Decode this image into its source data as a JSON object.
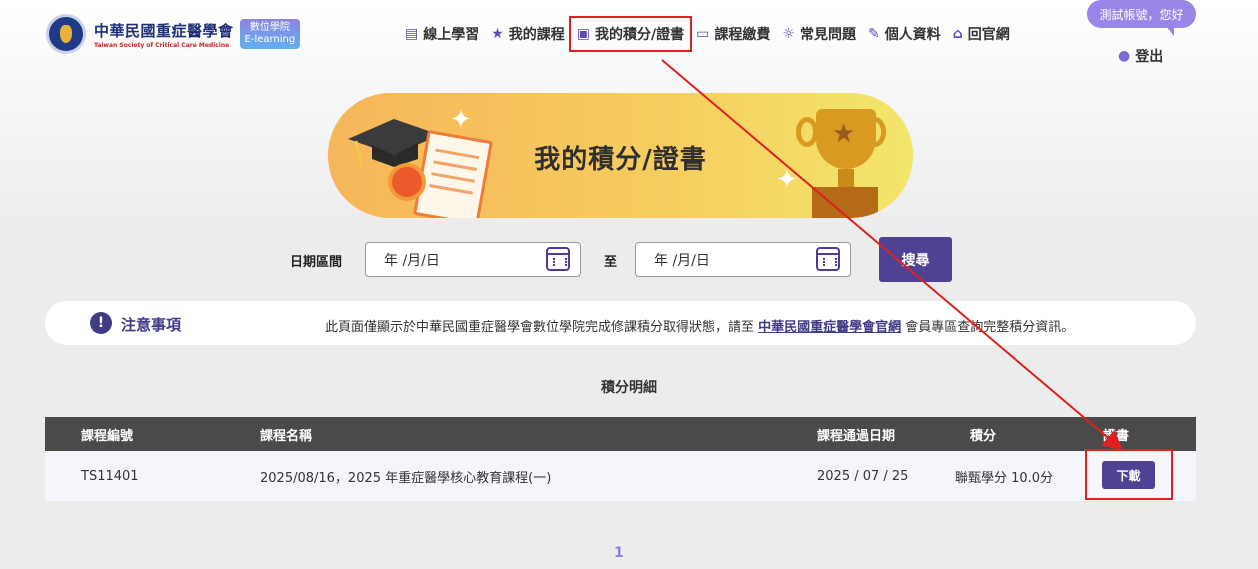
{
  "header": {
    "logo_cn": "中華民國重症醫學會",
    "logo_en": "Taiwan Society of Critical Care Medicine",
    "badge_line1": "數位學院",
    "badge_line2": "E-learning",
    "nav": [
      {
        "label": "線上學習",
        "icon": "book-icon"
      },
      {
        "label": "我的課程",
        "icon": "star-icon"
      },
      {
        "label": "我的積分/證書",
        "icon": "certificate-icon",
        "active": true
      },
      {
        "label": "課程繳費",
        "icon": "card-icon"
      },
      {
        "label": "常見問題",
        "icon": "bulb-icon"
      },
      {
        "label": "個人資料",
        "icon": "pencil-icon"
      },
      {
        "label": "回官網",
        "icon": "home-icon"
      }
    ],
    "greeting": "測試帳號，您好",
    "logout": "登出"
  },
  "banner": {
    "title": "我的積分/證書"
  },
  "filter": {
    "label": "日期區間",
    "from_placeholder": "年 /月/日",
    "separator": "至",
    "to_placeholder": "年 /月/日",
    "search_label": "搜尋"
  },
  "notice": {
    "title": "注意事項",
    "text_before": "此頁面僅顯示於中華民國重症醫學會數位學院完成修課積分取得狀態，請至 ",
    "link": "中華民國重症醫學會官網",
    "text_after": " 會員專區查詢完整積分資訊。"
  },
  "table": {
    "title": "積分明細",
    "columns": [
      "課程編號",
      "課程名稱",
      "課程通過日期",
      "積分",
      "證書"
    ],
    "rows": [
      {
        "id": "TS11401",
        "name": "2025/08/16，2025 年重症醫學核心教育課程(一)",
        "date": "2025 / 07 / 25",
        "credit": "聯甄學分 10.0分",
        "action": "下載"
      }
    ]
  },
  "pagination": {
    "current": "1"
  },
  "colors": {
    "accent": "#4f4294",
    "highlight": "#e21f1f"
  }
}
